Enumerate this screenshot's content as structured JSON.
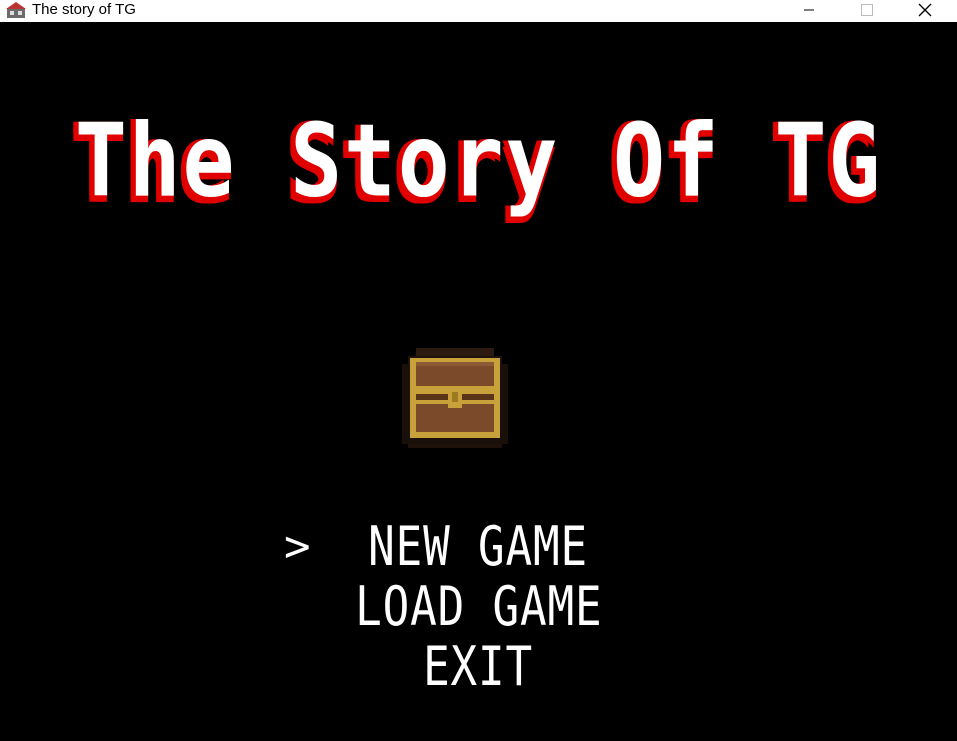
{
  "window": {
    "title": "The story of TG",
    "minimize_icon": "minimize-icon",
    "maximize_icon": "maximize-icon",
    "close_icon": "close-icon"
  },
  "game": {
    "title": "The Story Of TG",
    "emblem_icon": "treasure-chest-icon",
    "menu": {
      "cursor": ">",
      "selected_index": 0,
      "items": [
        {
          "label": "NEW GAME"
        },
        {
          "label": "LOAD GAME"
        },
        {
          "label": "EXIT"
        }
      ]
    },
    "colors": {
      "background": "#000000",
      "title_fill": "#ffffff",
      "title_shadow": "#e00000",
      "menu_text": "#ffffff",
      "chest_wood": "#7a4a2a",
      "chest_trim": "#c9a13a"
    }
  }
}
